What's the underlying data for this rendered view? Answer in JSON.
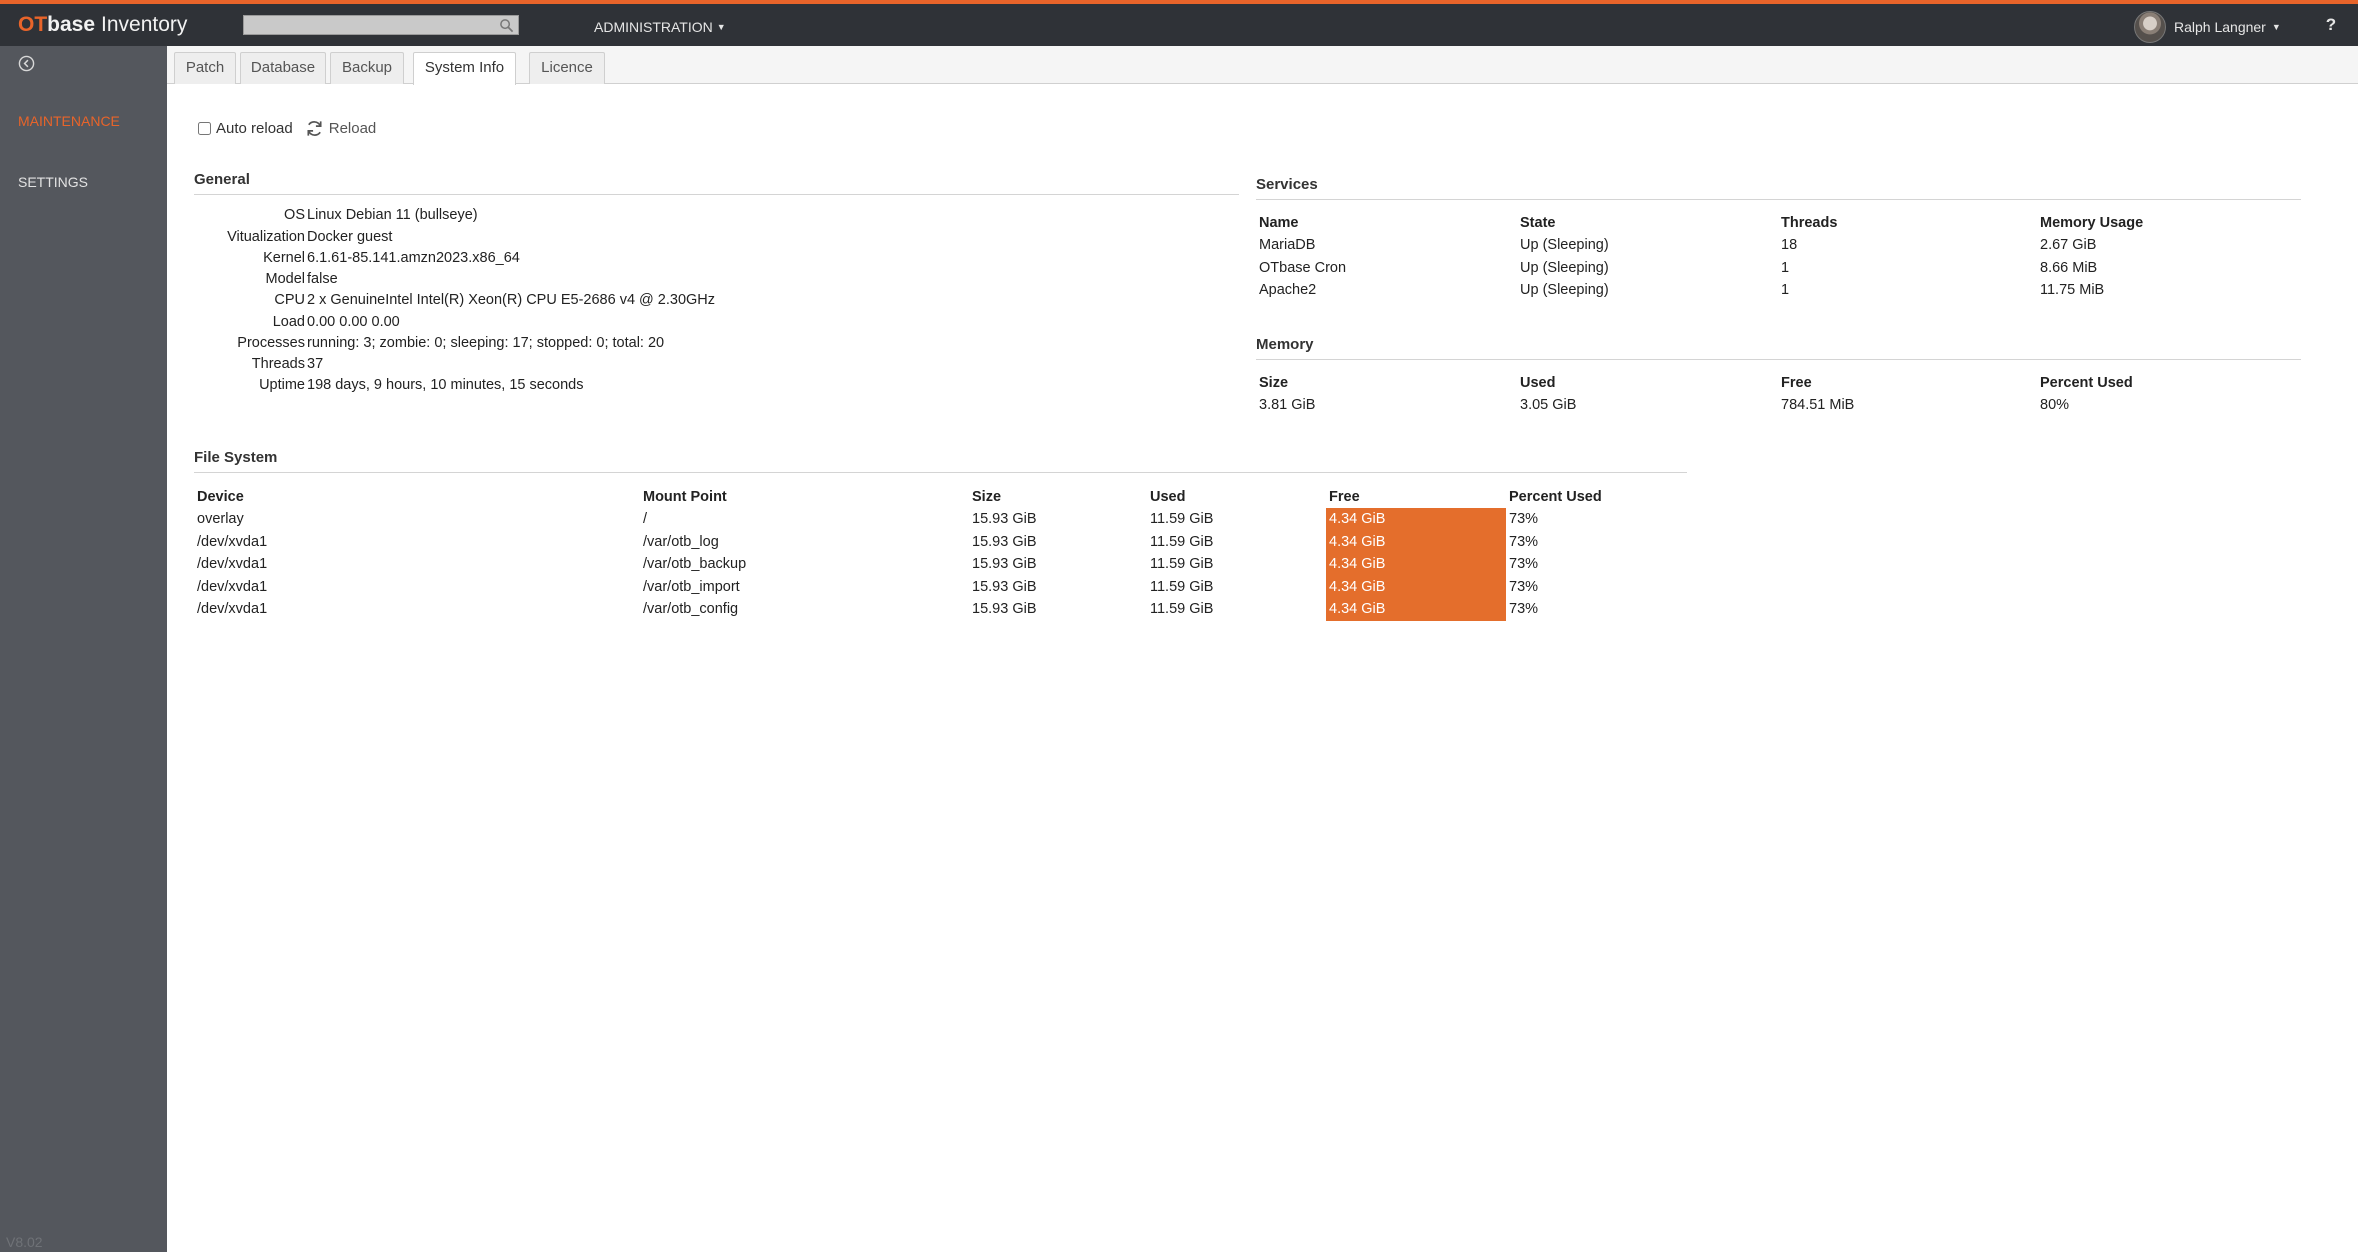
{
  "app": {
    "logo_ot": "OT",
    "logo_base": "base",
    "logo_product": "Inventory",
    "menu_admin": "ADMINISTRATION",
    "user_name": "Ralph Langner",
    "help": "?",
    "search_placeholder": "",
    "accent_color": "#e8642a"
  },
  "sidebar": {
    "items": [
      {
        "label": "MAINTENANCE",
        "active": true
      },
      {
        "label": "SETTINGS",
        "active": false
      }
    ],
    "version": "V8.02"
  },
  "tabs": [
    {
      "label": "Patch"
    },
    {
      "label": "Database"
    },
    {
      "label": "Backup"
    },
    {
      "label": "System Info",
      "active": true
    },
    {
      "label": "Licence"
    }
  ],
  "controls": {
    "auto_reload_label": "Auto reload",
    "auto_reload_checked": false,
    "reload_label": "Reload"
  },
  "general": {
    "title": "General",
    "rows": [
      {
        "key": "OS",
        "value": "Linux Debian 11 (bullseye)"
      },
      {
        "key": "Vitualization",
        "value": "Docker guest"
      },
      {
        "key": "Kernel",
        "value": "6.1.61-85.141.amzn2023.x86_64"
      },
      {
        "key": "Model",
        "value": "false"
      },
      {
        "key": "CPU",
        "value": "2 x GenuineIntel Intel(R) Xeon(R) CPU E5-2686 v4 @ 2.30GHz"
      },
      {
        "key": "Load",
        "value": "0.00 0.00 0.00"
      },
      {
        "key": "Processes",
        "value": "running: 3; zombie: 0; sleeping: 17; stopped: 0; total: 20"
      },
      {
        "key": "Threads",
        "value": "37"
      },
      {
        "key": "Uptime",
        "value": "198 days, 9 hours, 10 minutes, 15 seconds"
      }
    ]
  },
  "services": {
    "title": "Services",
    "headers": [
      "Name",
      "State",
      "Threads",
      "Memory Usage"
    ],
    "rows": [
      [
        "MariaDB",
        "Up (Sleeping)",
        "18",
        "2.67 GiB"
      ],
      [
        "OTbase Cron",
        "Up (Sleeping)",
        "1",
        "8.66 MiB"
      ],
      [
        "Apache2",
        "Up (Sleeping)",
        "1",
        "11.75 MiB"
      ]
    ]
  },
  "memory": {
    "title": "Memory",
    "headers": [
      "Size",
      "Used",
      "Free",
      "Percent Used"
    ],
    "rows": [
      [
        "3.81 GiB",
        "3.05 GiB",
        "784.51 MiB",
        "80%"
      ]
    ]
  },
  "filesystem": {
    "title": "File System",
    "headers": [
      "Device",
      "Mount Point",
      "Size",
      "Used",
      "Free",
      "Percent Used"
    ],
    "rows": [
      [
        "overlay",
        "/",
        "15.93 GiB",
        "11.59 GiB",
        "4.34 GiB",
        "73%"
      ],
      [
        "/dev/xvda1",
        "/var/otb_log",
        "15.93 GiB",
        "11.59 GiB",
        "4.34 GiB",
        "73%"
      ],
      [
        "/dev/xvda1",
        "/var/otb_backup",
        "15.93 GiB",
        "11.59 GiB",
        "4.34 GiB",
        "73%"
      ],
      [
        "/dev/xvda1",
        "/var/otb_import",
        "15.93 GiB",
        "11.59 GiB",
        "4.34 GiB",
        "73%"
      ],
      [
        "/dev/xvda1",
        "/var/otb_config",
        "15.93 GiB",
        "11.59 GiB",
        "4.34 GiB",
        "73%"
      ]
    ],
    "free_highlight_color": "#e46e2c"
  }
}
